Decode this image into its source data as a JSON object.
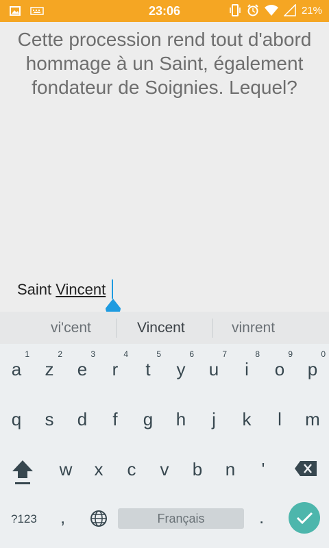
{
  "status_bar": {
    "time": "23:06",
    "battery": "21%",
    "icons_left": [
      "image-icon",
      "keyboard-icon"
    ],
    "icons_right": [
      "vibrate-icon",
      "alarm-icon",
      "wifi-icon",
      "signal-icon",
      "battery-icon"
    ],
    "color": "#f5a623"
  },
  "question": {
    "text": "Cette procession rend tout d'abord hommage à un Saint, également fondateur de Soignies. Lequel?"
  },
  "answer": {
    "prefix": "Saint ",
    "composing": "Vincent"
  },
  "suggestions": {
    "left": "vi'cent",
    "center": "Vincent",
    "right": "vinrent",
    "more": "..."
  },
  "keyboard": {
    "row1": [
      {
        "ch": "a",
        "hint": "1"
      },
      {
        "ch": "z",
        "hint": "2"
      },
      {
        "ch": "e",
        "hint": "3"
      },
      {
        "ch": "r",
        "hint": "4"
      },
      {
        "ch": "t",
        "hint": "5"
      },
      {
        "ch": "y",
        "hint": "6"
      },
      {
        "ch": "u",
        "hint": "7"
      },
      {
        "ch": "i",
        "hint": "8"
      },
      {
        "ch": "o",
        "hint": "9"
      },
      {
        "ch": "p",
        "hint": "0"
      }
    ],
    "row2": [
      "q",
      "s",
      "d",
      "f",
      "g",
      "h",
      "j",
      "k",
      "l",
      "m"
    ],
    "row3": [
      "w",
      "x",
      "c",
      "v",
      "b",
      "n",
      "'"
    ],
    "symbols_label": "?123",
    "comma": ",",
    "space_label": "Français",
    "period": ".",
    "enter_color": "#4db6ac"
  }
}
